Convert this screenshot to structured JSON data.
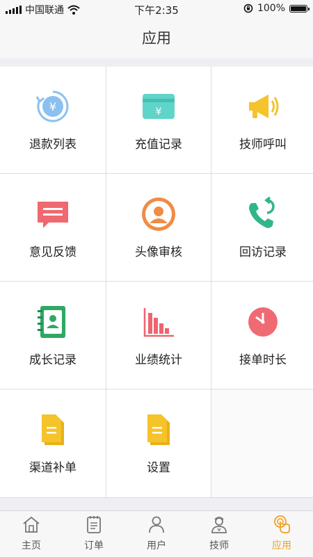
{
  "status_bar": {
    "carrier": "中国联通",
    "time": "下午2:35",
    "battery": "100%"
  },
  "nav": {
    "title": "应用"
  },
  "grid": {
    "items": [
      {
        "label": "退款列表",
        "icon": "refund-icon"
      },
      {
        "label": "充值记录",
        "icon": "recharge-icon"
      },
      {
        "label": "技师呼叫",
        "icon": "megaphone-icon"
      },
      {
        "label": "意见反馈",
        "icon": "feedback-icon"
      },
      {
        "label": "头像审核",
        "icon": "avatar-review-icon"
      },
      {
        "label": "回访记录",
        "icon": "callback-phone-icon"
      },
      {
        "label": "成长记录",
        "icon": "growth-book-icon"
      },
      {
        "label": "业绩统计",
        "icon": "bar-chart-icon"
      },
      {
        "label": "接单时长",
        "icon": "clock-icon"
      },
      {
        "label": "渠道补单",
        "icon": "document-icon"
      },
      {
        "label": "设置",
        "icon": "document-icon"
      }
    ]
  },
  "tabs": [
    {
      "label": "主页",
      "icon": "home-icon",
      "active": false
    },
    {
      "label": "订单",
      "icon": "order-list-icon",
      "active": false
    },
    {
      "label": "用户",
      "icon": "user-icon",
      "active": false
    },
    {
      "label": "技师",
      "icon": "technician-icon",
      "active": false
    },
    {
      "label": "应用",
      "icon": "apps-touch-icon",
      "active": true
    }
  ],
  "colors": {
    "accent": "#f0a020",
    "background": "#efeff3",
    "divider": "#dcdce0"
  }
}
